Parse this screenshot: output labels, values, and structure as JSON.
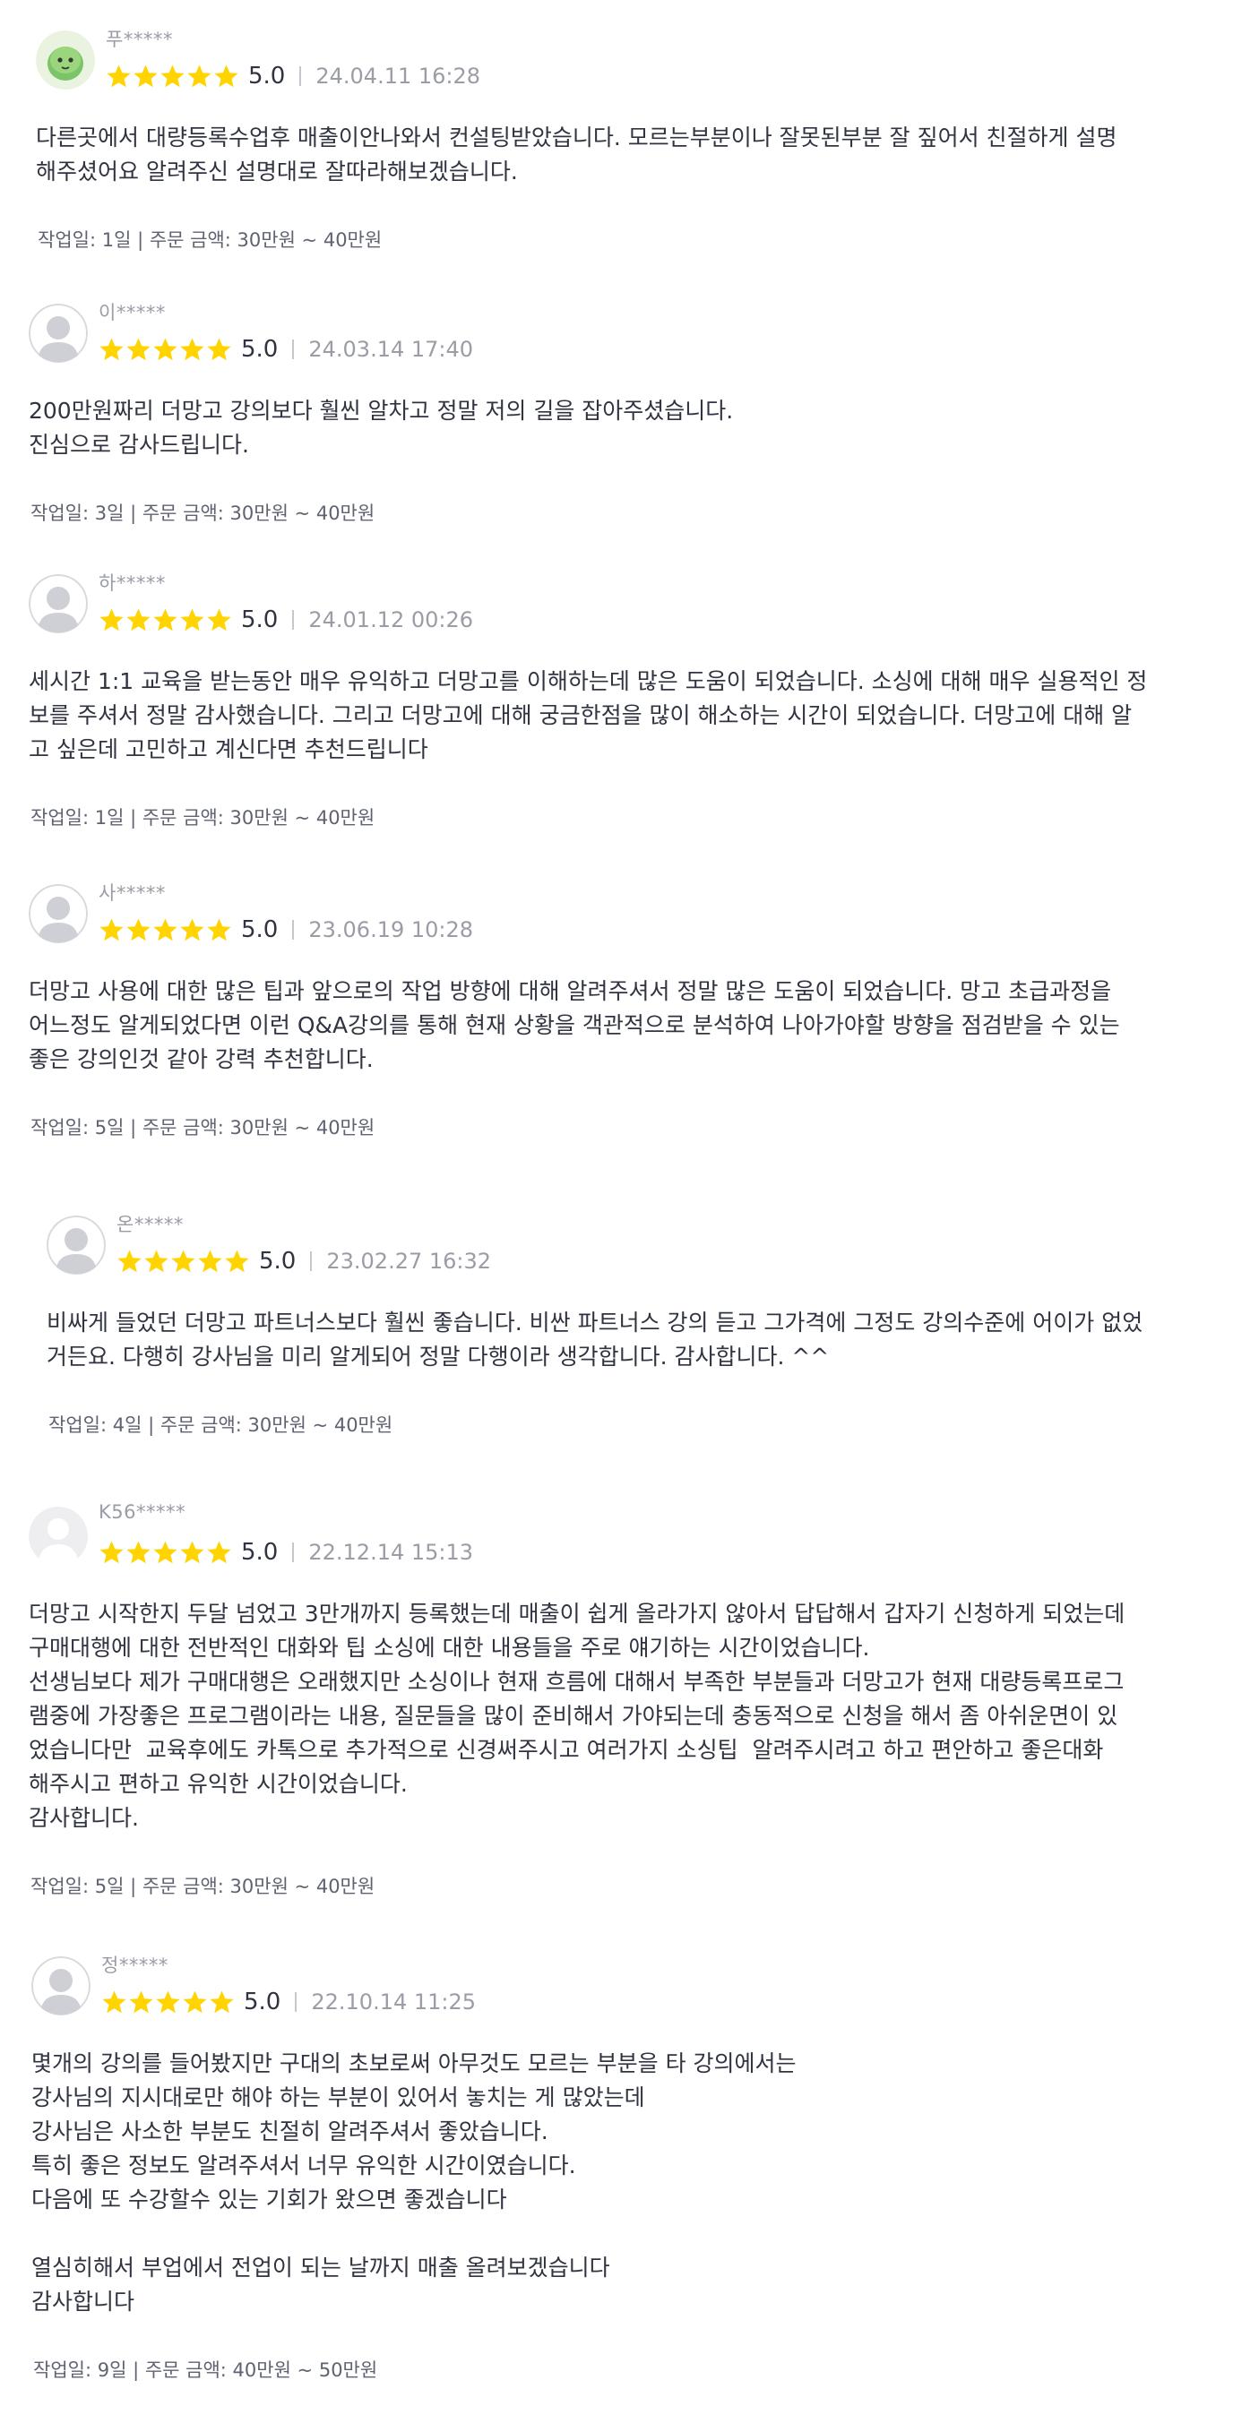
{
  "reviews": [
    {
      "name": "푸*****",
      "score": "5.0",
      "stars": 5,
      "date": "24.04.11 16:28",
      "body": "다른곳에서 대량등록수업후 매출이안나와서 컨설팅받았습니다. 모르는부분이나 잘못된부분 잘 짚어서 친절하게 설명\n해주셨어요 알려주신 설명대로 잘따라해보겠습니다.",
      "meta": "작업일: 1일 | 주문 금액: 30만원 ~ 40만원",
      "avatar": "character-avatar"
    },
    {
      "name": "이*****",
      "score": "5.0",
      "stars": 5,
      "date": "24.03.14 17:40",
      "body": "200만원짜리 더망고 강의보다 훨씬 알차고 정말 저의 길을 잡아주셨습니다.\n진심으로 감사드립니다.",
      "meta": "작업일: 3일 | 주문 금액: 30만원 ~ 40만원",
      "avatar": "default-avatar"
    },
    {
      "name": "하*****",
      "score": "5.0",
      "stars": 5,
      "date": "24.01.12 00:26",
      "body": "세시간 1:1 교육을 받는동안 매우 유익하고 더망고를 이해하는데 많은 도움이 되었습니다. 소싱에 대해 매우 실용적인 정\n보를 주셔서 정말 감사했습니다. 그리고 더망고에 대해 궁금한점을 많이 해소하는 시간이 되었습니다. 더망고에 대해 알\n고 싶은데 고민하고 계신다면 추천드립니다",
      "meta": "작업일: 1일 | 주문 금액: 30만원 ~ 40만원",
      "avatar": "default-avatar"
    },
    {
      "name": "사*****",
      "score": "5.0",
      "stars": 5,
      "date": "23.06.19 10:28",
      "body": "더망고 사용에 대한 많은 팁과 앞으로의 작업 방향에 대해 알려주셔서 정말 많은 도움이 되었습니다. 망고 초급과정을\n어느정도 알게되었다면 이런 Q&A강의를 통해 현재 상황을 객관적으로 분석하여 나아가야할 방향을 점검받을 수 있는\n좋은 강의인것 같아 강력 추천합니다.",
      "meta": "작업일: 5일 | 주문 금액: 30만원 ~ 40만원",
      "avatar": "default-avatar"
    },
    {
      "name": "온*****",
      "score": "5.0",
      "stars": 5,
      "date": "23.02.27 16:32",
      "body": "비싸게 들었던 더망고 파트너스보다 훨씬 좋습니다. 비싼 파트너스 강의 듣고 그가격에 그정도 강의수준에 어이가 없었\n거든요. 다행히 강사님을 미리 알게되어 정말 다행이라 생각합니다. 감사합니다. ^^",
      "meta": "작업일: 4일 | 주문 금액: 30만원 ~ 40만원",
      "avatar": "default-avatar"
    },
    {
      "name": "K56*****",
      "score": "5.0",
      "stars": 5,
      "date": "22.12.14 15:13",
      "body": "더망고 시작한지 두달 넘었고 3만개까지 등록했는데 매출이 쉽게 올라가지 않아서 답답해서 갑자기 신청하게 되었는데\n구매대행에 대한 전반적인 대화와 팁 소싱에 대한 내용들을 주로 얘기하는 시간이었습니다.\n선생님보다 제가 구매대행은 오래했지만 소싱이나 현재 흐름에 대해서 부족한 부분들과 더망고가 현재 대량등록프로그\n램중에 가장좋은 프로그램이라는 내용, 질문들을 많이 준비해서 가야되는데 충동적으로 신청을 해서 좀 아쉬운면이 있\n었습니다만  교육후에도 카톡으로 추가적으로 신경써주시고 여러가지 소싱팁  알려주시려고 하고 편안하고 좋은대화\n해주시고 편하고 유익한 시간이었습니다.\n감사합니다.",
      "meta": "작업일: 5일 | 주문 금액: 30만원 ~ 40만원",
      "avatar": "default-avatar-square"
    },
    {
      "name": "정*****",
      "score": "5.0",
      "stars": 5,
      "date": "22.10.14 11:25",
      "body": "몇개의 강의를 들어봤지만 구대의 초보로써 아무것도 모르는 부분을 타 강의에서는\n강사님의 지시대로만 해야 하는 부분이 있어서 놓치는 게 많았는데\n강사님은 사소한 부분도 친절히 알려주셔서 좋았습니다.\n특히 좋은 정보도 알려주셔서 너무 유익한 시간이였습니다.\n다음에 또 수강할수 있는 기회가 왔으면 좋겠습니다\n\n열심히해서 부업에서 전업이 되는 날까지 매출 올려보겠습니다\n감사합니다",
      "meta": "작업일: 9일 | 주문 금액: 40만원 ~ 50만원",
      "avatar": "default-avatar"
    }
  ],
  "colors": {
    "star": "#FFD400",
    "text": "#303441",
    "muted": "#9A9CA6"
  }
}
